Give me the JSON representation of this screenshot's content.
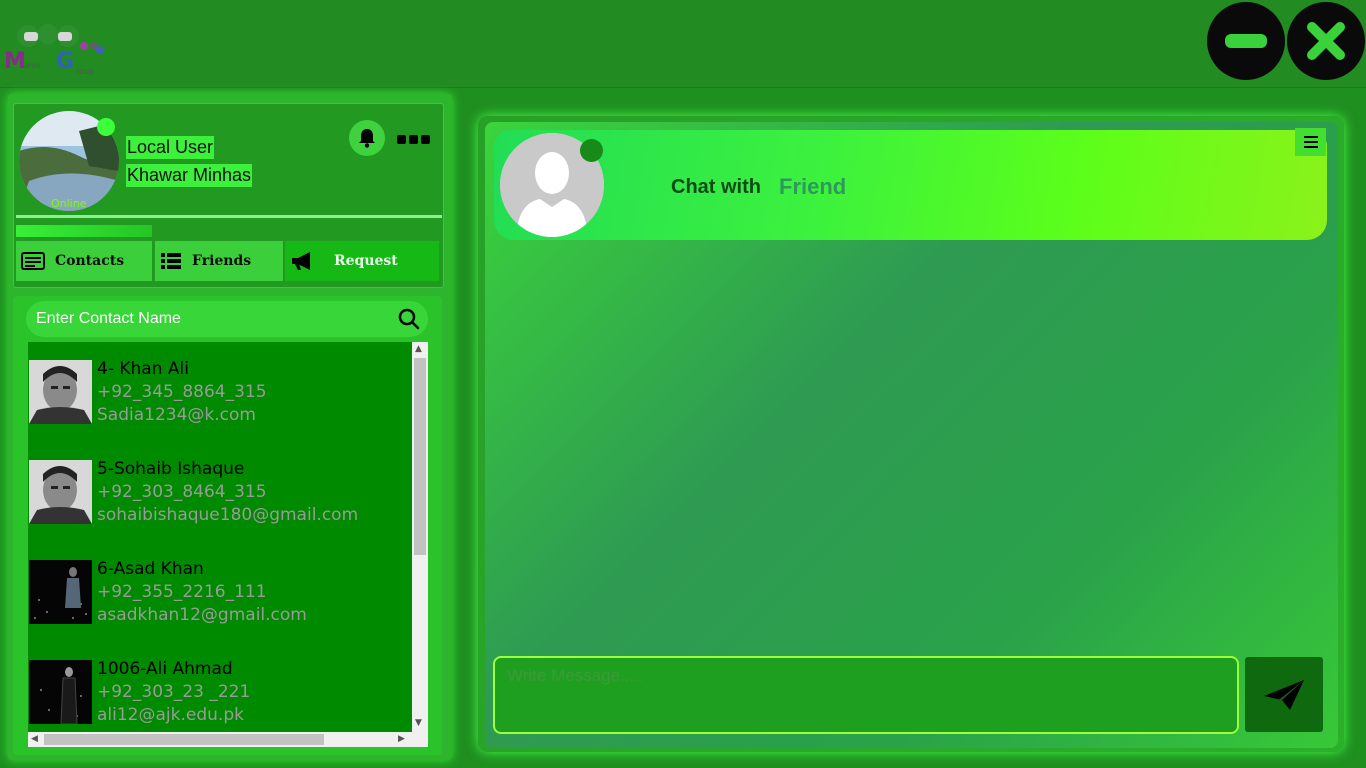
{
  "app": {
    "logo_letters": [
      "M",
      "G"
    ],
    "logo_small_text": [
      "anis",
      "roup"
    ]
  },
  "window_controls": {
    "minimize_icon": "minus-icon",
    "close_icon": "close-icon"
  },
  "profile": {
    "line1": "Local User",
    "line2": "Khawar Minhas",
    "status": "Online",
    "status_color": "#3cff3c",
    "bell_icon": "bell-icon",
    "menu_icon": "more-dots-icon",
    "progress_fraction": 0.32
  },
  "tabs": [
    {
      "label": "Contacts",
      "icon": "contacts-card-icon"
    },
    {
      "label": "Friends",
      "icon": "list-icon"
    },
    {
      "label": "Request",
      "icon": "megaphone-icon",
      "active": true
    }
  ],
  "search": {
    "placeholder": "Enter Contact Name",
    "icon": "search-icon"
  },
  "contacts": [
    {
      "name": "4- Khan  Ali",
      "phone": "+92_345_8864_315",
      "email": "Sadia1234@k.com"
    },
    {
      "name": "5-Sohaib  Ishaque",
      "phone": "+92_303_8464_315",
      "email": "sohaibishaque180@gmail.com"
    },
    {
      "name": "6-Asad Khan",
      "phone": "+92_355_2216_111",
      "email": "asadkhan12@gmail.com"
    },
    {
      "name": "1006-Ali Ahmad",
      "phone": "+92_303_23 _221",
      "email": "ali12@ajk.edu.pk"
    }
  ],
  "chat": {
    "title_prefix": "Chat with",
    "friend": "Friend",
    "menu_icon": "hamburger-icon",
    "message_placeholder": "Write Message.....",
    "send_icon": "paper-plane-icon"
  },
  "colors": {
    "background": "#1f8f1f",
    "accent": "#3cf03c",
    "online": "#3cff3c"
  }
}
